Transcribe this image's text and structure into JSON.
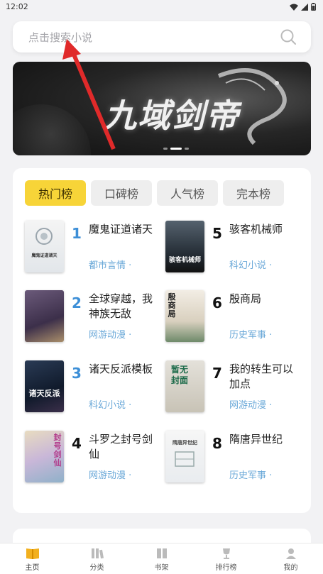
{
  "status": {
    "time": "12:02"
  },
  "search": {
    "placeholder": "点击搜索小说"
  },
  "banner": {
    "title": "九域剑帝"
  },
  "tabs": [
    {
      "label": "热门榜",
      "active": true
    },
    {
      "label": "口碑榜",
      "active": false
    },
    {
      "label": "人气榜",
      "active": false
    },
    {
      "label": "完本榜",
      "active": false
    }
  ],
  "books": [
    {
      "rank": "1",
      "title": "魔鬼证道诸天",
      "category": "都市言情 ·",
      "cover_text": "魔鬼证道诸天"
    },
    {
      "rank": "2",
      "title": "全球穿越，我神族无敌",
      "category": "网游动漫 ·",
      "cover_text": ""
    },
    {
      "rank": "3",
      "title": "诸天反派模板",
      "category": "科幻小说 ·",
      "cover_text": "诸天反派"
    },
    {
      "rank": "4",
      "title": "斗罗之封号剑仙",
      "category": "网游动漫 ·",
      "cover_text": "封号剑仙"
    },
    {
      "rank": "5",
      "title": "骇客机械师",
      "category": "科幻小说 ·",
      "cover_text": "骇客机械师"
    },
    {
      "rank": "6",
      "title": "殷商局",
      "category": "历史军事 ·",
      "cover_text": "殷商局"
    },
    {
      "rank": "7",
      "title": "我的转生可以加点",
      "category": "网游动漫 ·",
      "cover_text": "暂无封面"
    },
    {
      "rank": "8",
      "title": "隋唐异世纪",
      "category": "历史军事 ·",
      "cover_text": "隋唐异世纪"
    }
  ],
  "tabbar": [
    {
      "label": "主页",
      "icon": "book-open-icon",
      "active": true
    },
    {
      "label": "分类",
      "icon": "category-icon",
      "active": false
    },
    {
      "label": "书架",
      "icon": "bookshelf-icon",
      "active": false
    },
    {
      "label": "排行榜",
      "icon": "trophy-icon",
      "active": false
    },
    {
      "label": "我的",
      "icon": "user-icon",
      "active": false
    }
  ],
  "colors": {
    "accent": "#f7d438",
    "link": "#6aa8d8",
    "rank_top": "#3d8fd7"
  }
}
